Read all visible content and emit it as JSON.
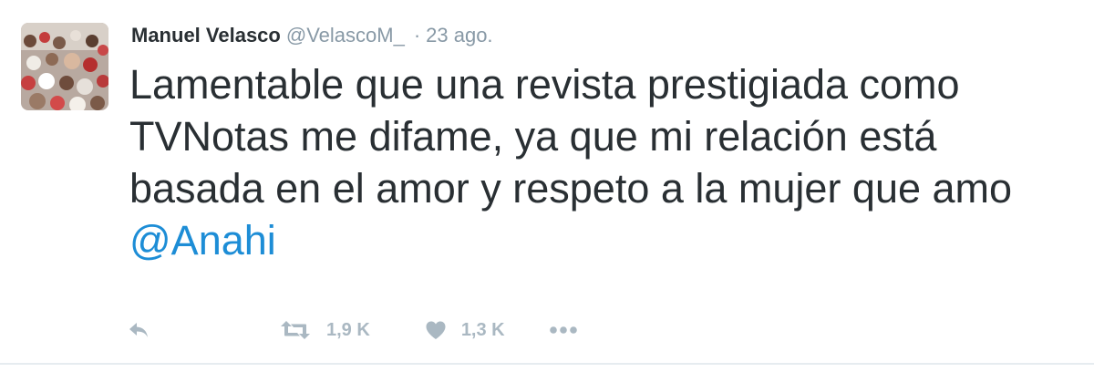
{
  "tweet": {
    "author_name": "Manuel Velasco",
    "author_handle": "@VelascoM_",
    "separator": "·",
    "timestamp": "23 ago.",
    "text_before_mention": "Lamentable que una revista prestigiada como TVNotas me difame, ya que mi relación está basada en el amor y respeto a la mujer que amo ",
    "mention": "@Anahi",
    "retweet_count": "1,9 K",
    "like_count": "1,3 K"
  },
  "icons": {
    "reply": "reply-icon",
    "retweet": "retweet-icon",
    "like": "heart-icon",
    "more": "more-icon"
  },
  "colors": {
    "name": "#292f33",
    "secondary": "#8899a6",
    "mention": "#1d8dd6",
    "action_icons": "#aab8c2"
  }
}
